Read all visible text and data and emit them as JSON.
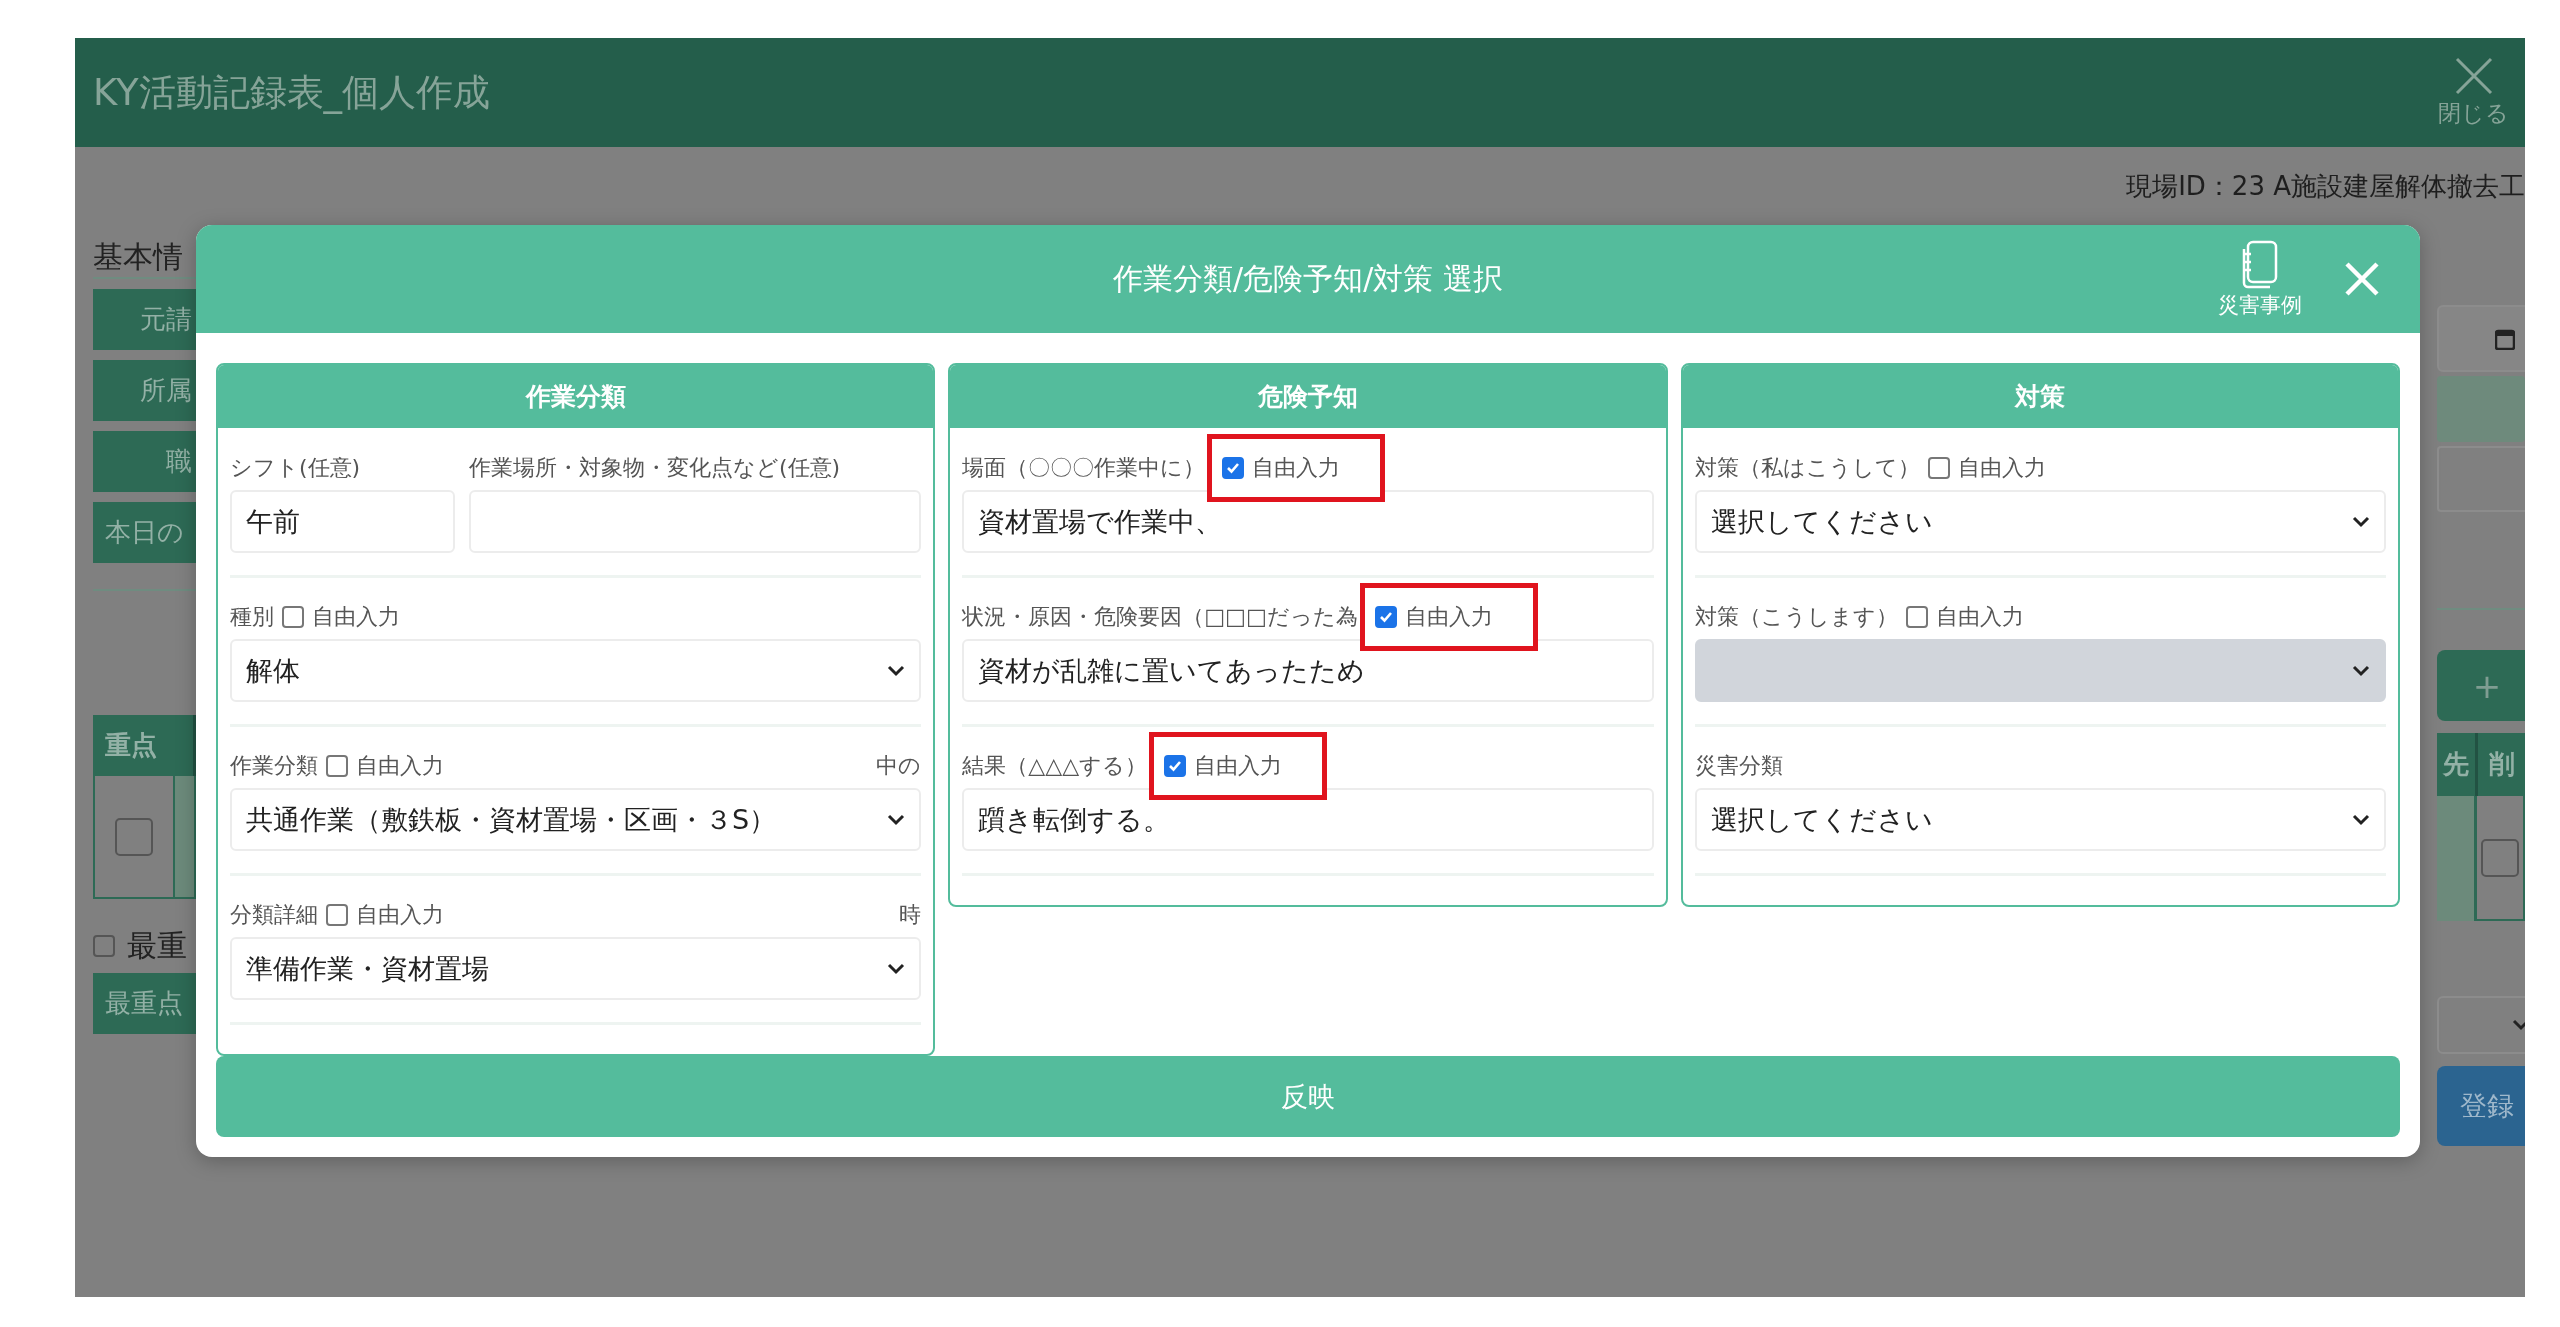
{
  "app": {
    "title": "KY活動記録表_個人作成",
    "close_label": "閉じる",
    "site_id": "現場ID：23 A施設建屋解体撤去工"
  },
  "background": {
    "left": {
      "section_title": "基本情",
      "buttons": [
        "元請",
        "所属",
        "職",
        "本日の"
      ],
      "table_header": "重点",
      "row_checked": false,
      "option_label": "最重",
      "option_checked": false,
      "bottom_button": "最重点"
    },
    "right": {
      "add_button": "+",
      "table_headers": [
        "先",
        "削"
      ],
      "row_checked": false,
      "save_button": "登録"
    }
  },
  "modal": {
    "title": "作業分類/危険予知/対策 選択",
    "cases_button": "災害事例",
    "columns": [
      {
        "title": "作業分類",
        "fields": [
          {
            "kind": "pair",
            "items": [
              {
                "label": "シフト(任意)",
                "value": "午前"
              },
              {
                "label": "作業場所・対象物・変化点など(任意)"
              }
            ]
          },
          {
            "kind": "select",
            "label": "種別",
            "free_input": {
              "label": "自由入力",
              "checked": false,
              "highlighted": false
            },
            "value": "解体"
          },
          {
            "kind": "select",
            "label": "作業分類",
            "free_input": {
              "label": "自由入力",
              "checked": false,
              "highlighted": false
            },
            "note": "中の",
            "value": "共通作業（敷鉄板・資材置場・区画・３S）"
          },
          {
            "kind": "select",
            "label": "分類詳細",
            "free_input": {
              "label": "自由入力",
              "checked": false,
              "highlighted": false
            },
            "note": "時",
            "value": "準備作業・資材置場"
          }
        ]
      },
      {
        "title": "危険予知",
        "fields": [
          {
            "kind": "text",
            "label": "場面（〇〇〇作業中に）",
            "free_input": {
              "label": "自由入力",
              "checked": true,
              "highlighted": true
            },
            "value": "資材置場で作業中、"
          },
          {
            "kind": "text",
            "label": "状況・原因・危険要因（□□□だった為",
            "free_input": {
              "label": "自由入力",
              "checked": true,
              "highlighted": true
            },
            "value": "資材が乱雑に置いてあったため"
          },
          {
            "kind": "text",
            "label": "結果（△△△する）",
            "free_input": {
              "label": "自由入力",
              "checked": true,
              "highlighted": true
            },
            "value": "躓き転倒する。"
          }
        ]
      },
      {
        "title": "対策",
        "fields": [
          {
            "kind": "select",
            "label": "対策（私はこうして）",
            "free_input": {
              "label": "自由入力",
              "checked": false,
              "highlighted": false
            },
            "value": "選択してください"
          },
          {
            "kind": "select",
            "label": "対策（こうします）",
            "free_input": {
              "label": "自由入力",
              "checked": false,
              "highlighted": false
            },
            "disabled": true
          },
          {
            "kind": "select",
            "label": "災害分類",
            "value": "選択してください"
          }
        ]
      }
    ],
    "apply_button": "反映"
  }
}
